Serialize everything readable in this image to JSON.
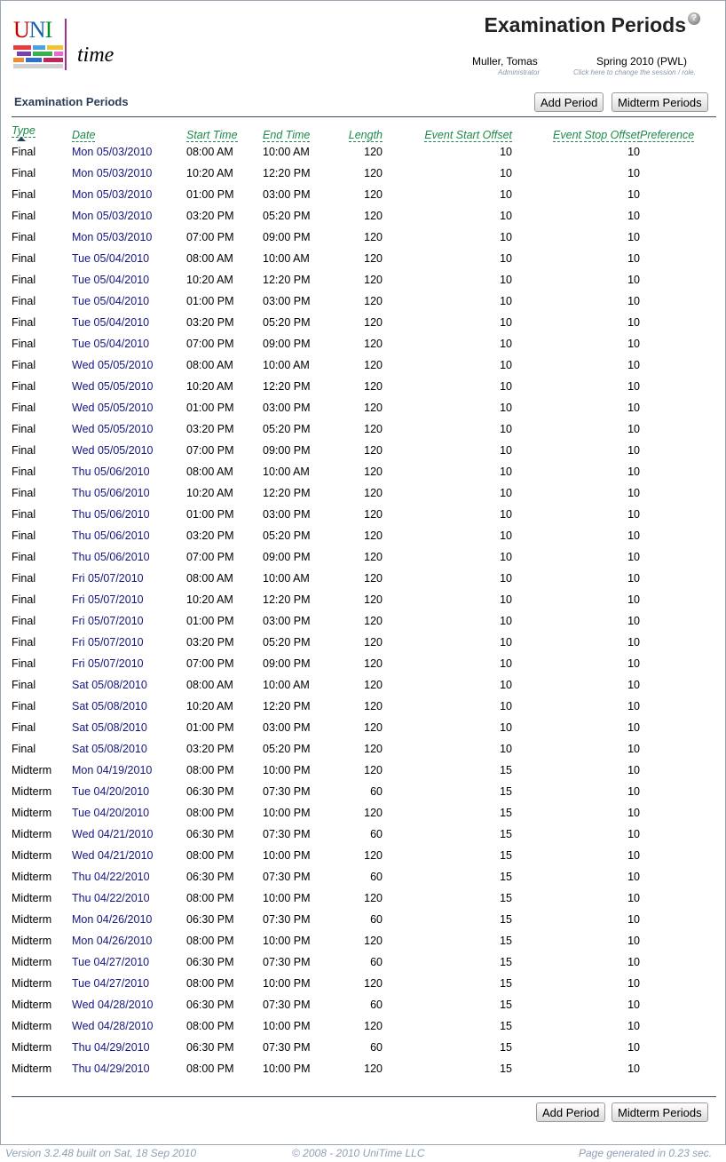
{
  "header": {
    "logo_text_uni": "UNI",
    "logo_text_time": "time",
    "page_title": "Examination Periods",
    "help_icon": "help-icon",
    "user_name": "Muller, Tomas",
    "user_role": "Administrator",
    "session_name": "Spring 2010 (PWL)",
    "session_hint": "Click here to change the session / role."
  },
  "section": {
    "title": "Examination Periods"
  },
  "buttons": {
    "add_period": "Add Period",
    "midterm_periods": "Midterm Periods"
  },
  "table": {
    "columns": [
      "Type",
      "Date",
      "Start Time",
      "End Time",
      "Length",
      "Event Start Offset",
      "Event Stop Offset",
      "Preference"
    ],
    "sorted_by": "Type",
    "rows": [
      [
        "Final",
        "Mon 05/03/2010",
        "08:00 AM",
        "10:00 AM",
        "120",
        "10",
        "10",
        ""
      ],
      [
        "Final",
        "Mon 05/03/2010",
        "10:20 AM",
        "12:20 PM",
        "120",
        "10",
        "10",
        ""
      ],
      [
        "Final",
        "Mon 05/03/2010",
        "01:00 PM",
        "03:00 PM",
        "120",
        "10",
        "10",
        ""
      ],
      [
        "Final",
        "Mon 05/03/2010",
        "03:20 PM",
        "05:20 PM",
        "120",
        "10",
        "10",
        ""
      ],
      [
        "Final",
        "Mon 05/03/2010",
        "07:00 PM",
        "09:00 PM",
        "120",
        "10",
        "10",
        ""
      ],
      [
        "Final",
        "Tue 05/04/2010",
        "08:00 AM",
        "10:00 AM",
        "120",
        "10",
        "10",
        ""
      ],
      [
        "Final",
        "Tue 05/04/2010",
        "10:20 AM",
        "12:20 PM",
        "120",
        "10",
        "10",
        ""
      ],
      [
        "Final",
        "Tue 05/04/2010",
        "01:00 PM",
        "03:00 PM",
        "120",
        "10",
        "10",
        ""
      ],
      [
        "Final",
        "Tue 05/04/2010",
        "03:20 PM",
        "05:20 PM",
        "120",
        "10",
        "10",
        ""
      ],
      [
        "Final",
        "Tue 05/04/2010",
        "07:00 PM",
        "09:00 PM",
        "120",
        "10",
        "10",
        ""
      ],
      [
        "Final",
        "Wed 05/05/2010",
        "08:00 AM",
        "10:00 AM",
        "120",
        "10",
        "10",
        ""
      ],
      [
        "Final",
        "Wed 05/05/2010",
        "10:20 AM",
        "12:20 PM",
        "120",
        "10",
        "10",
        ""
      ],
      [
        "Final",
        "Wed 05/05/2010",
        "01:00 PM",
        "03:00 PM",
        "120",
        "10",
        "10",
        ""
      ],
      [
        "Final",
        "Wed 05/05/2010",
        "03:20 PM",
        "05:20 PM",
        "120",
        "10",
        "10",
        ""
      ],
      [
        "Final",
        "Wed 05/05/2010",
        "07:00 PM",
        "09:00 PM",
        "120",
        "10",
        "10",
        ""
      ],
      [
        "Final",
        "Thu 05/06/2010",
        "08:00 AM",
        "10:00 AM",
        "120",
        "10",
        "10",
        ""
      ],
      [
        "Final",
        "Thu 05/06/2010",
        "10:20 AM",
        "12:20 PM",
        "120",
        "10",
        "10",
        ""
      ],
      [
        "Final",
        "Thu 05/06/2010",
        "01:00 PM",
        "03:00 PM",
        "120",
        "10",
        "10",
        ""
      ],
      [
        "Final",
        "Thu 05/06/2010",
        "03:20 PM",
        "05:20 PM",
        "120",
        "10",
        "10",
        ""
      ],
      [
        "Final",
        "Thu 05/06/2010",
        "07:00 PM",
        "09:00 PM",
        "120",
        "10",
        "10",
        ""
      ],
      [
        "Final",
        "Fri 05/07/2010",
        "08:00 AM",
        "10:00 AM",
        "120",
        "10",
        "10",
        ""
      ],
      [
        "Final",
        "Fri 05/07/2010",
        "10:20 AM",
        "12:20 PM",
        "120",
        "10",
        "10",
        ""
      ],
      [
        "Final",
        "Fri 05/07/2010",
        "01:00 PM",
        "03:00 PM",
        "120",
        "10",
        "10",
        ""
      ],
      [
        "Final",
        "Fri 05/07/2010",
        "03:20 PM",
        "05:20 PM",
        "120",
        "10",
        "10",
        ""
      ],
      [
        "Final",
        "Fri 05/07/2010",
        "07:00 PM",
        "09:00 PM",
        "120",
        "10",
        "10",
        ""
      ],
      [
        "Final",
        "Sat 05/08/2010",
        "08:00 AM",
        "10:00 AM",
        "120",
        "10",
        "10",
        ""
      ],
      [
        "Final",
        "Sat 05/08/2010",
        "10:20 AM",
        "12:20 PM",
        "120",
        "10",
        "10",
        ""
      ],
      [
        "Final",
        "Sat 05/08/2010",
        "01:00 PM",
        "03:00 PM",
        "120",
        "10",
        "10",
        ""
      ],
      [
        "Final",
        "Sat 05/08/2010",
        "03:20 PM",
        "05:20 PM",
        "120",
        "10",
        "10",
        ""
      ],
      [
        "Midterm",
        "Mon 04/19/2010",
        "08:00 PM",
        "10:00 PM",
        "120",
        "15",
        "10",
        ""
      ],
      [
        "Midterm",
        "Tue 04/20/2010",
        "06:30 PM",
        "07:30 PM",
        "60",
        "15",
        "10",
        ""
      ],
      [
        "Midterm",
        "Tue 04/20/2010",
        "08:00 PM",
        "10:00 PM",
        "120",
        "15",
        "10",
        ""
      ],
      [
        "Midterm",
        "Wed 04/21/2010",
        "06:30 PM",
        "07:30 PM",
        "60",
        "15",
        "10",
        ""
      ],
      [
        "Midterm",
        "Wed 04/21/2010",
        "08:00 PM",
        "10:00 PM",
        "120",
        "15",
        "10",
        ""
      ],
      [
        "Midterm",
        "Thu 04/22/2010",
        "06:30 PM",
        "07:30 PM",
        "60",
        "15",
        "10",
        ""
      ],
      [
        "Midterm",
        "Thu 04/22/2010",
        "08:00 PM",
        "10:00 PM",
        "120",
        "15",
        "10",
        ""
      ],
      [
        "Midterm",
        "Mon 04/26/2010",
        "06:30 PM",
        "07:30 PM",
        "60",
        "15",
        "10",
        ""
      ],
      [
        "Midterm",
        "Mon 04/26/2010",
        "08:00 PM",
        "10:00 PM",
        "120",
        "15",
        "10",
        ""
      ],
      [
        "Midterm",
        "Tue 04/27/2010",
        "06:30 PM",
        "07:30 PM",
        "60",
        "15",
        "10",
        ""
      ],
      [
        "Midterm",
        "Tue 04/27/2010",
        "08:00 PM",
        "10:00 PM",
        "120",
        "15",
        "10",
        ""
      ],
      [
        "Midterm",
        "Wed 04/28/2010",
        "06:30 PM",
        "07:30 PM",
        "60",
        "15",
        "10",
        ""
      ],
      [
        "Midterm",
        "Wed 04/28/2010",
        "08:00 PM",
        "10:00 PM",
        "120",
        "15",
        "10",
        ""
      ],
      [
        "Midterm",
        "Thu 04/29/2010",
        "06:30 PM",
        "07:30 PM",
        "60",
        "15",
        "10",
        ""
      ],
      [
        "Midterm",
        "Thu 04/29/2010",
        "08:00 PM",
        "10:00 PM",
        "120",
        "15",
        "10",
        ""
      ]
    ]
  },
  "footer": {
    "version": "Version 3.2.48 built on Sat, 18 Sep 2010",
    "copyright": "© 2008 - 2010 UniTime LLC",
    "generated": "Page generated in 0.23 sec."
  },
  "colors": {
    "date_link": "#141680",
    "header_link": "#1c8a4a",
    "section_title": "#2a3e56",
    "footer_text": "#8ea0b5"
  }
}
